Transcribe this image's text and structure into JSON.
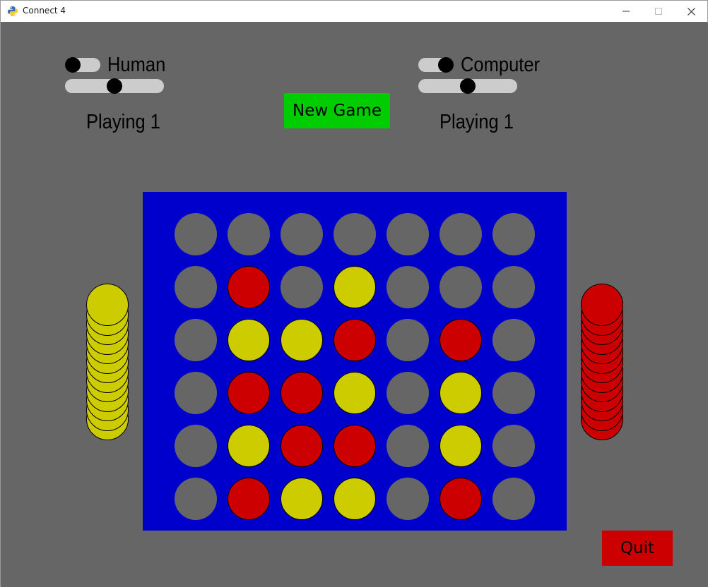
{
  "window": {
    "title": "Connect 4",
    "icon": "python-icon"
  },
  "colors": {
    "background": "#666666",
    "board": "#0000cc",
    "empty_slot": "#666666",
    "yellow": "#cccc00",
    "red": "#cc0000",
    "new_game_button": "#00cc00",
    "quit_button": "#cc0000"
  },
  "players": [
    {
      "name": "Human",
      "status": "Playing 1",
      "toggle_on": false,
      "slider_level": 0.5
    },
    {
      "name": "Computer",
      "status": "Playing 1",
      "toggle_on": true,
      "slider_level": 0.5
    }
  ],
  "buttons": {
    "new_game": "New Game",
    "quit": "Quit"
  },
  "board": {
    "rows": 6,
    "columns": 7,
    "cells": [
      [
        "",
        "",
        "",
        "",
        "",
        "",
        ""
      ],
      [
        "",
        "R",
        "",
        "Y",
        "",
        "",
        ""
      ],
      [
        "",
        "Y",
        "Y",
        "R",
        "",
        "R",
        ""
      ],
      [
        "",
        "R",
        "R",
        "Y",
        "",
        "Y",
        ""
      ],
      [
        "",
        "Y",
        "R",
        "R",
        "",
        "Y",
        ""
      ],
      [
        "",
        "R",
        "Y",
        "Y",
        "",
        "R",
        ""
      ]
    ]
  },
  "reserve": {
    "yellow": 13,
    "red": 13
  }
}
